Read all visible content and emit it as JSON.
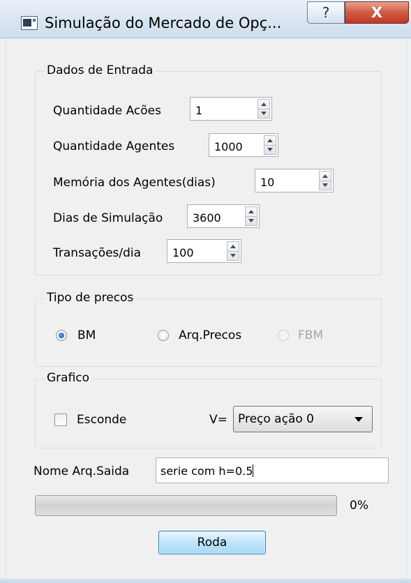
{
  "window": {
    "title": "Simulação do Mercado de Opç...",
    "help_glyph": "?",
    "close_glyph": "X"
  },
  "input_group": {
    "title": "Dados de Entrada",
    "fields": [
      {
        "label": "Quantidade Acões",
        "value": "1"
      },
      {
        "label": "Quantidade Agentes",
        "value": "1000"
      },
      {
        "label": "Memória dos Agentes(dias)",
        "value": "10"
      },
      {
        "label": "Dias de Simulação",
        "value": "3600"
      },
      {
        "label": "Transações/dia",
        "value": "100"
      }
    ]
  },
  "price_group": {
    "title": "Tipo de precos",
    "options": [
      {
        "label": "BM",
        "selected": true,
        "enabled": true
      },
      {
        "label": "Arq.Precos",
        "selected": false,
        "enabled": true
      },
      {
        "label": "FBM",
        "selected": false,
        "enabled": false
      }
    ]
  },
  "graph_group": {
    "title": "Grafico",
    "hide_checkbox_label": "Esconde",
    "hide_checked": false,
    "v_label": "V=",
    "v_selected": "Preço ação 0"
  },
  "output": {
    "label": "Nome Arq.Saida",
    "value": "serie com h=0.5"
  },
  "progress": {
    "value": 0,
    "text": "0%"
  },
  "run_button_label": "Roda",
  "colors": {
    "selection_accent": "#1f56a8",
    "close_button": "#c84c33",
    "button_border": "#3c7fb1"
  }
}
